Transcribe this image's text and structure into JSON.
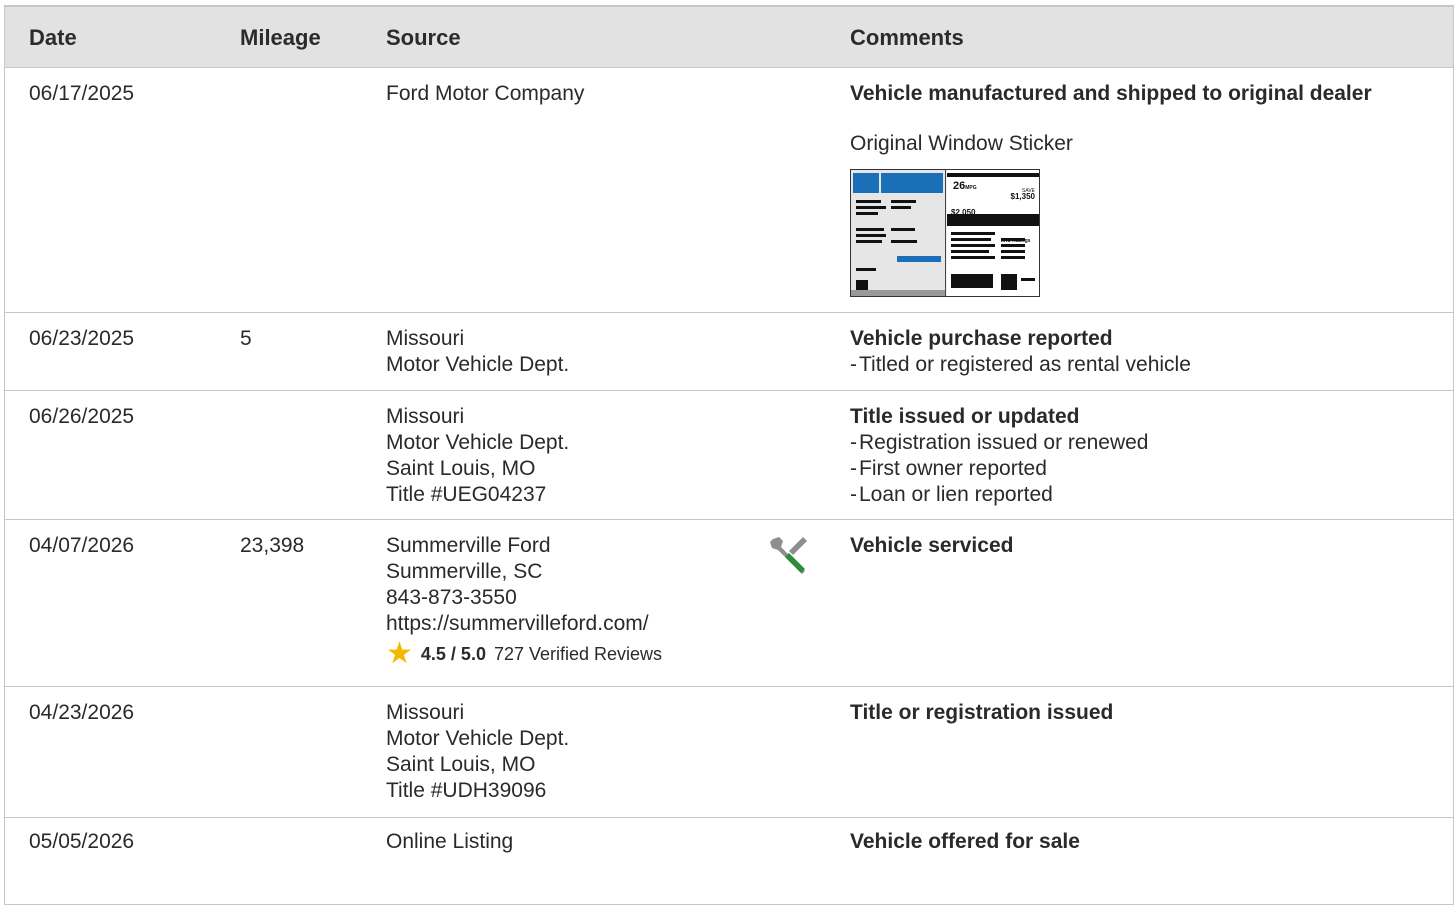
{
  "headers": {
    "date": "Date",
    "mileage": "Mileage",
    "source": "Source",
    "comments": "Comments"
  },
  "rows": [
    {
      "date": "06/17/2025",
      "mileage": "",
      "source": [
        "Ford Motor Company"
      ],
      "comment_title": "Vehicle manufactured and shipped to original dealer",
      "comment_items": [],
      "sticker_label": "Original Window Sticker",
      "sticker": {
        "mpg": "26",
        "mpg_unit": "MPG",
        "save_label": "SAVE",
        "save_amount": "$1,350",
        "cost": "$2,050",
        "ratings_title": "IIHS Ratings"
      }
    },
    {
      "date": "06/23/2025",
      "mileage": "5",
      "source": [
        "Missouri",
        "Motor Vehicle Dept."
      ],
      "comment_title": "Vehicle purchase reported",
      "comment_items": [
        "Titled or registered as rental vehicle"
      ]
    },
    {
      "date": "06/26/2025",
      "mileage": "",
      "source": [
        "Missouri",
        "Motor Vehicle Dept.",
        "Saint Louis, MO",
        "Title #UEG04237"
      ],
      "comment_title": "Title issued or updated",
      "comment_items": [
        "Registration issued or renewed",
        "First owner reported",
        "Loan or lien reported"
      ]
    },
    {
      "date": "04/07/2026",
      "mileage": "23,398",
      "source": [
        "Summerville Ford",
        "Summerville, SC",
        "843-873-3550",
        "https://summervilleford.com/"
      ],
      "rating": {
        "score": "4.5 / 5.0",
        "reviews": "727 Verified Reviews",
        "icon": "star-icon"
      },
      "service_icon": "wrench-screwdriver-icon",
      "comment_title": "Vehicle serviced",
      "comment_items": []
    },
    {
      "date": "04/23/2026",
      "mileage": "",
      "source": [
        "Missouri",
        "Motor Vehicle Dept.",
        "Saint Louis, MO",
        "Title #UDH39096"
      ],
      "comment_title": "Title or registration issued",
      "comment_items": []
    },
    {
      "date": "05/05/2026",
      "mileage": "",
      "source": [
        "Online Listing"
      ],
      "comment_title": "Vehicle offered for sale",
      "comment_items": []
    }
  ]
}
